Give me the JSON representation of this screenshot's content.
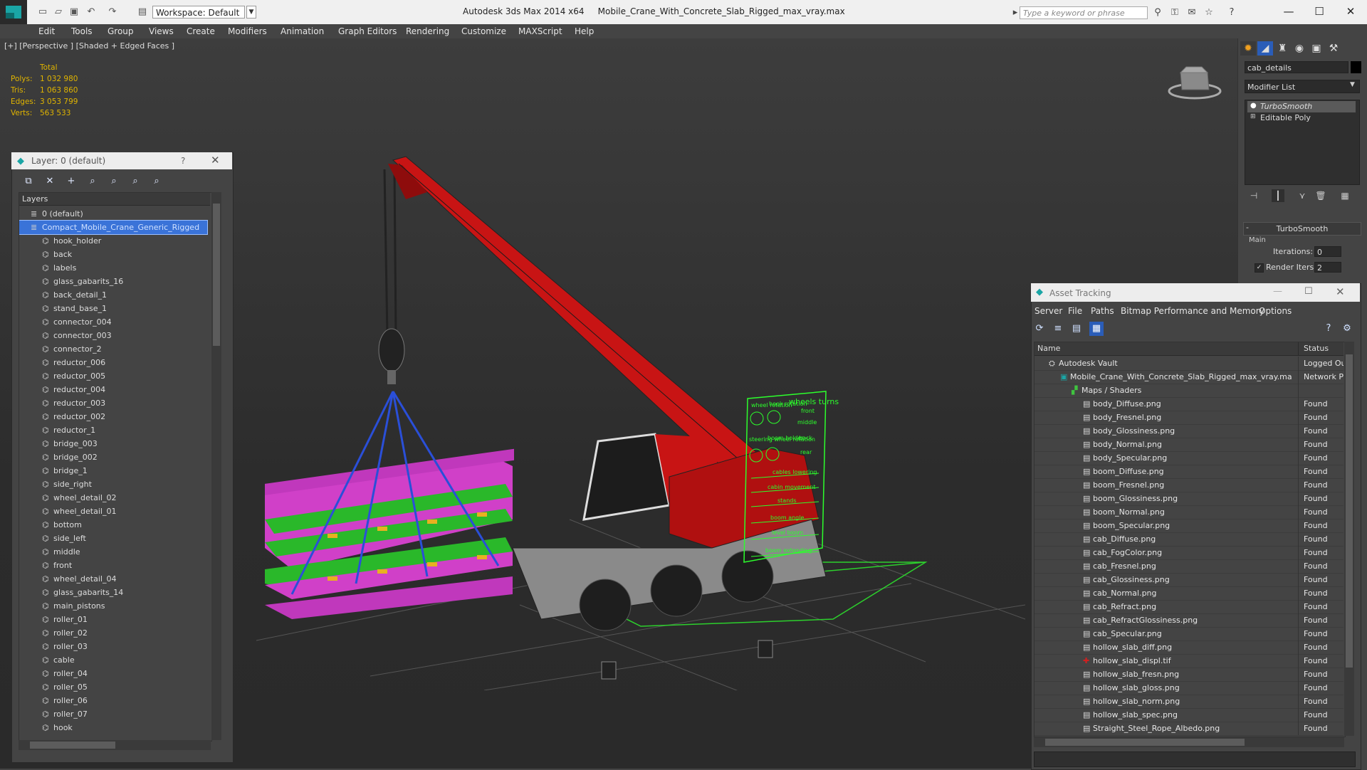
{
  "titlebar": {
    "app": "Autodesk 3ds Max  2014 x64",
    "file": "Mobile_Crane_With_Concrete_Slab_Rigged_max_vray.max",
    "workspace": "Workspace: Default",
    "search_placeholder": "Type a keyword or phrase"
  },
  "menu": [
    "Edit",
    "Tools",
    "Group",
    "Views",
    "Create",
    "Modifiers",
    "Animation",
    "Graph Editors",
    "Rendering",
    "Customize",
    "MAXScript",
    "Help"
  ],
  "viewport": {
    "label": "[+] [Perspective ] [Shaded + Edged Faces ]",
    "stats": {
      "header": "Total",
      "rows": [
        {
          "label": "Polys:",
          "value": "1 032 980"
        },
        {
          "label": "Tris:",
          "value": "1 063 860"
        },
        {
          "label": "Edges:",
          "value": "3 053 799"
        },
        {
          "label": "Verts:",
          "value": "563 533"
        }
      ]
    },
    "rig_labels": {
      "wheels_turns": "wheels turns",
      "wheel_rotation": "wheel rotation",
      "hook_rotation": "hook rotation",
      "steering_wheel_rotation": "steering wheel rotation",
      "boom_holder": "boom holder",
      "front": "front",
      "middle": "middle",
      "back": "back",
      "rear": "rear",
      "cables_lowering": "cables lowering",
      "cabin_movement": "cabin movement",
      "stands": "stands",
      "boom_angle": "boom angle",
      "level_boom": "level boom",
      "boom_extending": "boom extending"
    }
  },
  "command_panel": {
    "object_name": "cab_details",
    "modifier_list": "Modifier List",
    "stack": [
      "TurboSmooth",
      "Editable Poly"
    ],
    "rollout": "TurboSmooth",
    "group": "Main",
    "iterations_label": "Iterations:",
    "iterations_value": "0",
    "render_iters_label": "Render Iters:",
    "render_iters_value": "2"
  },
  "layer_panel": {
    "title": "Layer: 0 (default)",
    "help": "?",
    "header": "Layers",
    "items": [
      {
        "name": "0 (default)",
        "level": 0,
        "selected": false
      },
      {
        "name": "Compact_Mobile_Crane_Generic_Rigged",
        "level": 0,
        "selected": true
      },
      {
        "name": "hook_holder",
        "level": 1
      },
      {
        "name": "back",
        "level": 1
      },
      {
        "name": "labels",
        "level": 1
      },
      {
        "name": "glass_gabarits_16",
        "level": 1
      },
      {
        "name": "back_detail_1",
        "level": 1
      },
      {
        "name": "stand_base_1",
        "level": 1
      },
      {
        "name": "connector_004",
        "level": 1
      },
      {
        "name": "connector_003",
        "level": 1
      },
      {
        "name": "connector_2",
        "level": 1
      },
      {
        "name": "reductor_006",
        "level": 1
      },
      {
        "name": "reductor_005",
        "level": 1
      },
      {
        "name": "reductor_004",
        "level": 1
      },
      {
        "name": "reductor_003",
        "level": 1
      },
      {
        "name": "reductor_002",
        "level": 1
      },
      {
        "name": "reductor_1",
        "level": 1
      },
      {
        "name": "bridge_003",
        "level": 1
      },
      {
        "name": "bridge_002",
        "level": 1
      },
      {
        "name": "bridge_1",
        "level": 1
      },
      {
        "name": "side_right",
        "level": 1
      },
      {
        "name": "wheel_detail_02",
        "level": 1
      },
      {
        "name": "wheel_detail_01",
        "level": 1
      },
      {
        "name": "bottom",
        "level": 1
      },
      {
        "name": "side_left",
        "level": 1
      },
      {
        "name": "middle",
        "level": 1
      },
      {
        "name": "front",
        "level": 1
      },
      {
        "name": "wheel_detail_04",
        "level": 1
      },
      {
        "name": "glass_gabarits_14",
        "level": 1
      },
      {
        "name": "main_pistons",
        "level": 1
      },
      {
        "name": "roller_01",
        "level": 1
      },
      {
        "name": "roller_02",
        "level": 1
      },
      {
        "name": "roller_03",
        "level": 1
      },
      {
        "name": "cable",
        "level": 1
      },
      {
        "name": "roller_04",
        "level": 1
      },
      {
        "name": "roller_05",
        "level": 1
      },
      {
        "name": "roller_06",
        "level": 1
      },
      {
        "name": "roller_07",
        "level": 1
      },
      {
        "name": "hook",
        "level": 1
      }
    ]
  },
  "asset_tracking": {
    "title": "Asset Tracking",
    "menu": [
      "Server",
      "File",
      "Paths",
      "Bitmap Performance and Memory",
      "Options"
    ],
    "columns": [
      "Name",
      "Status"
    ],
    "rows": [
      {
        "name": "Autodesk Vault",
        "status": "Logged Ou",
        "level": 0,
        "icon": "vault"
      },
      {
        "name": "Mobile_Crane_With_Concrete_Slab_Rigged_max_vray.max",
        "status": "Network P",
        "level": 1,
        "icon": "max"
      },
      {
        "name": "Maps / Shaders",
        "status": "",
        "level": 2,
        "icon": "folder"
      },
      {
        "name": "body_Diffuse.png",
        "status": "Found",
        "level": 3,
        "icon": "file"
      },
      {
        "name": "body_Fresnel.png",
        "status": "Found",
        "level": 3,
        "icon": "file"
      },
      {
        "name": "body_Glossiness.png",
        "status": "Found",
        "level": 3,
        "icon": "file"
      },
      {
        "name": "body_Normal.png",
        "status": "Found",
        "level": 3,
        "icon": "file"
      },
      {
        "name": "body_Specular.png",
        "status": "Found",
        "level": 3,
        "icon": "file"
      },
      {
        "name": "boom_Diffuse.png",
        "status": "Found",
        "level": 3,
        "icon": "file"
      },
      {
        "name": "boom_Fresnel.png",
        "status": "Found",
        "level": 3,
        "icon": "file"
      },
      {
        "name": "boom_Glossiness.png",
        "status": "Found",
        "level": 3,
        "icon": "file"
      },
      {
        "name": "boom_Normal.png",
        "status": "Found",
        "level": 3,
        "icon": "file"
      },
      {
        "name": "boom_Specular.png",
        "status": "Found",
        "level": 3,
        "icon": "file"
      },
      {
        "name": "cab_Diffuse.png",
        "status": "Found",
        "level": 3,
        "icon": "file"
      },
      {
        "name": "cab_FogColor.png",
        "status": "Found",
        "level": 3,
        "icon": "file"
      },
      {
        "name": "cab_Fresnel.png",
        "status": "Found",
        "level": 3,
        "icon": "file"
      },
      {
        "name": "cab_Glossiness.png",
        "status": "Found",
        "level": 3,
        "icon": "file"
      },
      {
        "name": "cab_Normal.png",
        "status": "Found",
        "level": 3,
        "icon": "file"
      },
      {
        "name": "cab_Refract.png",
        "status": "Found",
        "level": 3,
        "icon": "file"
      },
      {
        "name": "cab_RefractGlossiness.png",
        "status": "Found",
        "level": 3,
        "icon": "file"
      },
      {
        "name": "cab_Specular.png",
        "status": "Found",
        "level": 3,
        "icon": "file"
      },
      {
        "name": "hollow_slab_diff.png",
        "status": "Found",
        "level": 3,
        "icon": "file"
      },
      {
        "name": "hollow_slab_displ.tif",
        "status": "Found",
        "level": 3,
        "icon": "file-red"
      },
      {
        "name": "hollow_slab_fresn.png",
        "status": "Found",
        "level": 3,
        "icon": "file"
      },
      {
        "name": "hollow_slab_gloss.png",
        "status": "Found",
        "level": 3,
        "icon": "file"
      },
      {
        "name": "hollow_slab_norm.png",
        "status": "Found",
        "level": 3,
        "icon": "file"
      },
      {
        "name": "hollow_slab_spec.png",
        "status": "Found",
        "level": 3,
        "icon": "file"
      },
      {
        "name": "Straight_Steel_Rope_Albedo.png",
        "status": "Found",
        "level": 3,
        "icon": "file"
      }
    ]
  },
  "colors": {
    "accent_select": "#3a73d8",
    "stat_text": "#e0b400",
    "rig_green": "#2cff2c",
    "crane_red": "#c81414",
    "slab_magenta": "#d040c8",
    "slab_green": "#22b822"
  }
}
